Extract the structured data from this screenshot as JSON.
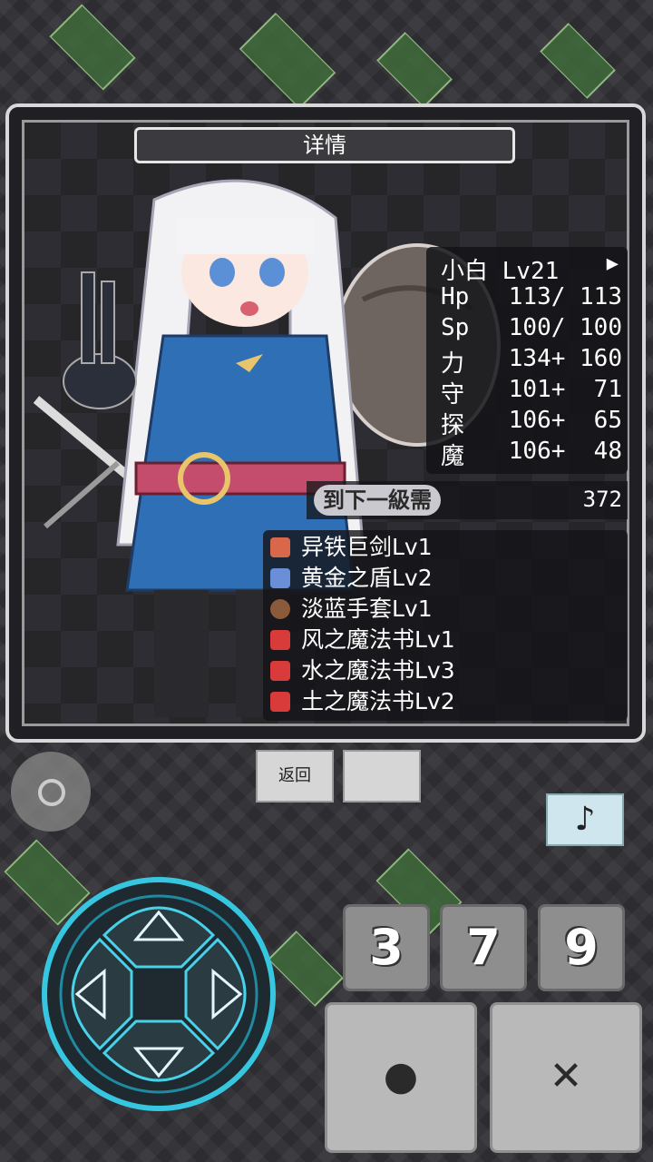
{
  "panel": {
    "title": "详情"
  },
  "character": {
    "name_level": "小白 Lv21",
    "stats": [
      {
        "label": "Hp",
        "value": "113/ 113"
      },
      {
        "label": "Sp",
        "value": "100/ 100"
      },
      {
        "label": "力",
        "value": "134+ 160"
      },
      {
        "label": "守",
        "value": "101+  71"
      },
      {
        "label": "探",
        "value": "106+  65"
      },
      {
        "label": "魔",
        "value": "106+  48"
      }
    ],
    "next_level_label": "到下一級需",
    "next_level_value": "372"
  },
  "equipment": [
    {
      "name": "异铁巨剑Lv1",
      "icon": "sword-icon",
      "color": "#d9684a"
    },
    {
      "name": "黄金之盾Lv2",
      "icon": "shield-icon",
      "color": "#6b8fd6"
    },
    {
      "name": "淡蓝手套Lv1",
      "icon": "glove-icon",
      "color": "#8a5a3a"
    },
    {
      "name": "风之魔法书Lv1",
      "icon": "spellbook-icon",
      "color": "#d93a3a"
    },
    {
      "name": "水之魔法书Lv3",
      "icon": "spellbook-icon",
      "color": "#d93a3a"
    },
    {
      "name": "土之魔法书Lv2",
      "icon": "spellbook-icon",
      "color": "#d93a3a"
    }
  ],
  "controls": {
    "back_label": "返回",
    "blank_label": "",
    "music_symbol": "♪",
    "num_buttons": [
      "3",
      "7",
      "9"
    ],
    "confirm_symbol": "●",
    "cancel_symbol": "✕"
  }
}
